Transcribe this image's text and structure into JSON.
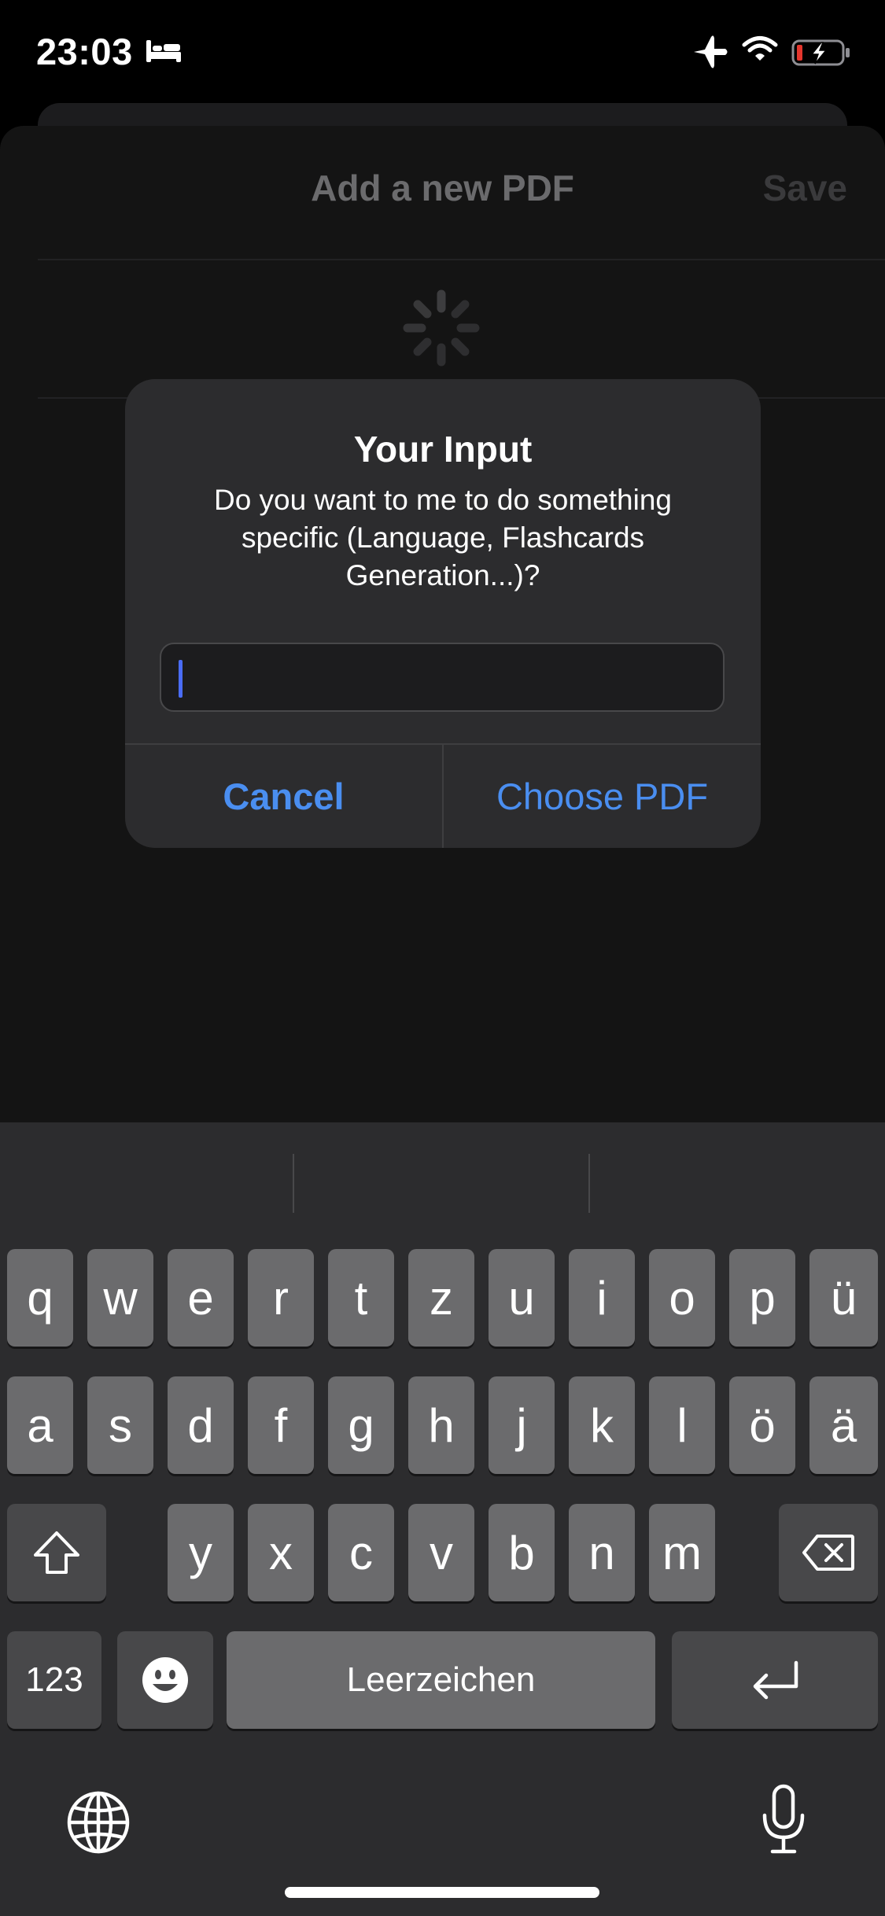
{
  "status_bar": {
    "time": "23:03",
    "icons": [
      "bed-icon",
      "airplane-icon",
      "wifi-icon",
      "battery-charging-icon"
    ],
    "battery_color": "#e5362d"
  },
  "sheet": {
    "title": "Add a new PDF",
    "save_label": "Save",
    "loading_icon": "activity-spinner-icon"
  },
  "alert": {
    "title": "Your Input",
    "message": "Do you want to me to do something specific (Language, Flashcards Generation...)?",
    "input_value": "",
    "cancel_label": "Cancel",
    "confirm_label": "Choose PDF",
    "accent_color": "#4a8ef0"
  },
  "keyboard": {
    "row1": [
      "q",
      "w",
      "e",
      "r",
      "t",
      "z",
      "u",
      "i",
      "o",
      "p",
      "ü"
    ],
    "row2": [
      "a",
      "s",
      "d",
      "f",
      "g",
      "h",
      "j",
      "k",
      "l",
      "ö",
      "ä"
    ],
    "row3": [
      "y",
      "x",
      "c",
      "v",
      "b",
      "n",
      "m"
    ],
    "numbers_label": "123",
    "space_label": "Leerzeichen",
    "icons": [
      "shift-icon",
      "delete-icon",
      "emoji-icon",
      "return-icon",
      "globe-icon",
      "microphone-icon"
    ]
  }
}
